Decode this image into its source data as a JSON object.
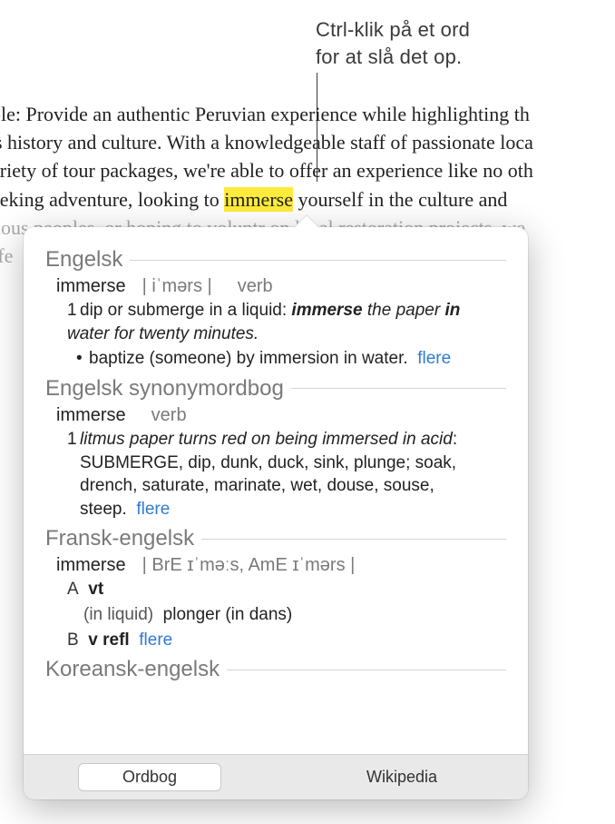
{
  "callout": {
    "line1": "Ctrl-klik på et ord",
    "line2": "for at slå det op."
  },
  "document": {
    "line1": "ble: Provide an authentic Peruvian experience while highlighting th",
    "line2": "'s history and culture. With a knowledgeable staff of passionate loca",
    "line3": "ariety of tour packages, we're able to offer an experience like no oth",
    "line4_pre": "eeking adventure, looking to ",
    "highlighted_word": "immerse",
    "line4_post": " yourself in the culture and",
    "line5_pre": "nous peoples, or hoping to volunt",
    "line5_post": "r on local restoration projects, we",
    "line6": "rfe"
  },
  "popover": {
    "sections": {
      "english": {
        "title": "Engelsk",
        "headword": "immerse",
        "pron": "| iˈmərs |",
        "pos": "verb",
        "def_num": "1",
        "def_text": "dip or submerge in a liquid: ",
        "example_b1": "immerse",
        "example_it1": " the paper ",
        "example_b2": "in",
        "example_it2": " water for twenty minutes.",
        "bullet_text": "baptize (someone) by immersion in water.",
        "more": "flere"
      },
      "thesaurus": {
        "title": "Engelsk synonymordbog",
        "headword": "immerse",
        "pos": "verb",
        "def_num": "1",
        "example_it": "litmus paper turns red on being immersed in acid",
        "syn_caps": "SUBMERGE",
        "syn_rest": ", dip, dunk, duck, sink, plunge; soak, drench, saturate, marinate, wet, douse, souse, steep.",
        "more": "flere"
      },
      "french": {
        "title": "Fransk-engelsk",
        "headword": "immerse",
        "pron": "| BrE ɪˈməːs,  AmE ɪˈmərs |",
        "a_label": "A",
        "a_pos": "vt",
        "a_hint": "(in liquid)",
        "a_trans": "plonger (in dans)",
        "b_label": "B",
        "b_pos": "v refl",
        "more": "flere"
      },
      "korean": {
        "title": "Koreansk-engelsk"
      }
    },
    "tabs": {
      "dictionary": "Ordbog",
      "wikipedia": "Wikipedia"
    }
  }
}
